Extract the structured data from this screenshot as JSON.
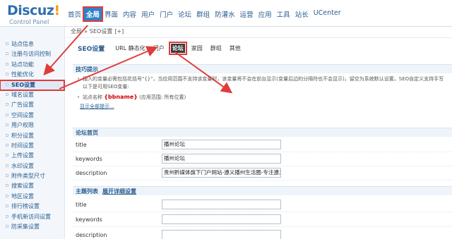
{
  "logo": {
    "main": "Discuz",
    "bang": "!",
    "sub": "Control Panel"
  },
  "topnav": [
    "首页",
    "全局",
    "界面",
    "内容",
    "用户",
    "门户",
    "论坛",
    "群组",
    "防灌水",
    "运营",
    "应用",
    "工具",
    "站长",
    "UCenter"
  ],
  "topnav_active": "全局",
  "breadcrumb": {
    "root": "全局",
    "sep": "»",
    "current": "SEO设置",
    "add": "[+]"
  },
  "sidebar": [
    "站点信息",
    "注册与访问控制",
    "站点功能",
    "性能优化",
    "SEO设置",
    "域名设置",
    "广告设置",
    "空间设置",
    "用户权限",
    "积分设置",
    "时间设置",
    "上传设置",
    "水印设置",
    "附件类型尺寸",
    "搜索设置",
    "地区设置",
    "排行榜设置",
    "手机新访问设置",
    "防采集设置"
  ],
  "sidebar_active": "SEO设置",
  "tabs": [
    "SEO设置",
    "URL 静态化",
    "门户",
    "论坛",
    "家园",
    "群组",
    "其他"
  ],
  "tab_current": "论坛",
  "tips": {
    "title": "技巧提示",
    "line1": "插入的变量必需包括花括号\"{}\"，当应用范围不支持该变量时，该变量将不会在前台显示(变量后边的分隔符也不会显示)，留空为系统默认设置，SEO自定义支持手写",
    "line1b": "以下是可用SEO变量:",
    "line2_prefix": "站点名称",
    "line2_code": "{bbname}",
    "line2_suffix": "(应用范围: 所有位置)",
    "more": "显示全部提示..."
  },
  "forum_home": {
    "title": "论坛首页",
    "fields": [
      {
        "label": "title",
        "value": "播州论坛"
      },
      {
        "label": "keywords",
        "value": "播州论坛"
      },
      {
        "label": "description",
        "value": "贵州黔媒体旗下门户网站-遵义播州生活圈-专注遵义播"
      }
    ]
  },
  "thread_list": {
    "title": "主题列表",
    "link": "展开详细设置",
    "fields": [
      {
        "label": "title",
        "value": ""
      },
      {
        "label": "keywords",
        "value": ""
      },
      {
        "label": "description",
        "value": ""
      }
    ]
  },
  "colors": {
    "accent": "#2f82c8",
    "highlight": "#e03c3c",
    "link": "#2a5d8f"
  }
}
